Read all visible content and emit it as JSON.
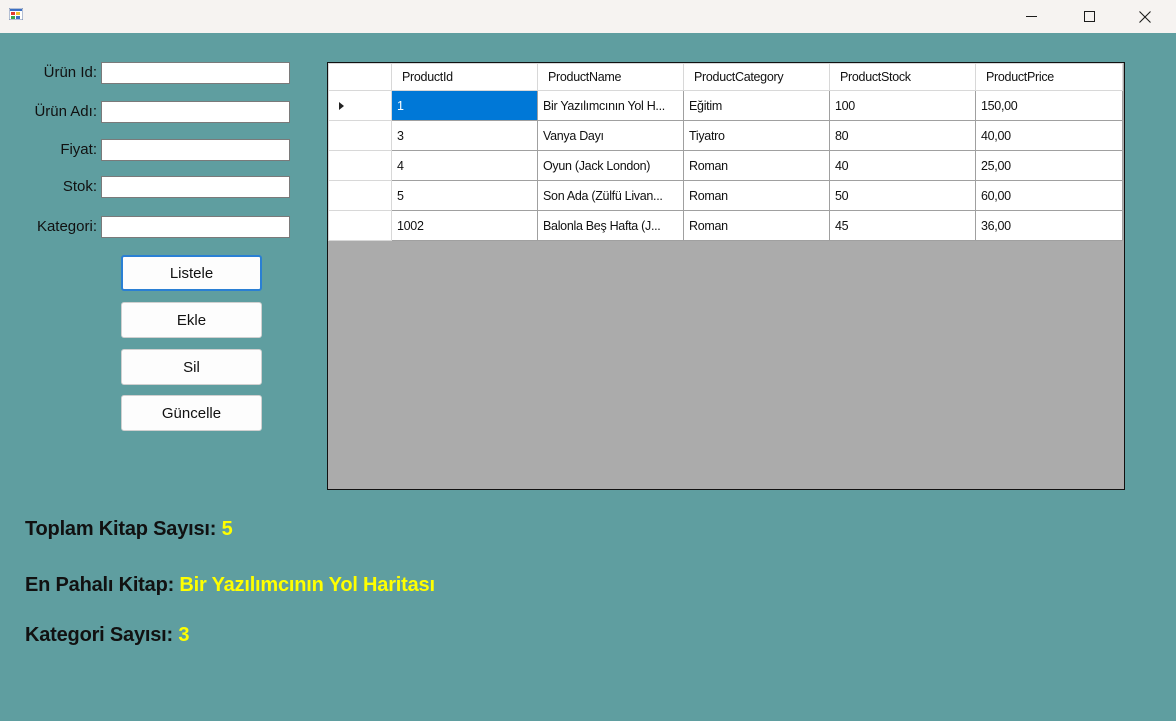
{
  "window": {
    "minimize_glyph": "—",
    "maximize_glyph": "☐",
    "close_glyph": "✕"
  },
  "form": {
    "fields": [
      {
        "label": "Ürün Id:",
        "value": ""
      },
      {
        "label": "Ürün Adı:",
        "value": ""
      },
      {
        "label": "Fiyat:",
        "value": ""
      },
      {
        "label": "Stok:",
        "value": ""
      },
      {
        "label": "Kategori:",
        "value": ""
      }
    ],
    "buttons": {
      "list": "Listele",
      "add": "Ekle",
      "delete": "Sil",
      "update": "Güncelle"
    }
  },
  "grid": {
    "columns": [
      "ProductId",
      "ProductName",
      "ProductCategory",
      "ProductStock",
      "ProductPrice"
    ],
    "rows": [
      [
        "1",
        "Bir Yazılımcının Yol H...",
        "Eğitim",
        "100",
        "150,00"
      ],
      [
        "3",
        "Vanya Dayı",
        "Tiyatro",
        "80",
        "40,00"
      ],
      [
        "4",
        "Oyun (Jack London)",
        "Roman",
        "40",
        "25,00"
      ],
      [
        "5",
        "Son Ada (Zülfü Livan...",
        "Roman",
        "50",
        "60,00"
      ],
      [
        "1002",
        "Balonla Beş Hafta (J...",
        "Roman",
        "45",
        "36,00"
      ]
    ],
    "selected_row": 0
  },
  "summary": {
    "total_label": "Toplam Kitap Sayısı:",
    "total_value": "5",
    "expensive_label": "En Pahalı Kitap:",
    "expensive_value": "Bir Yazılımcının Yol Haritası",
    "category_label": "Kategori Sayısı:",
    "category_value": "3"
  },
  "colors": {
    "background": "#5f9ea0",
    "highlight": "#ffff00",
    "selection": "#0078d7",
    "grid_empty": "#ababab"
  }
}
